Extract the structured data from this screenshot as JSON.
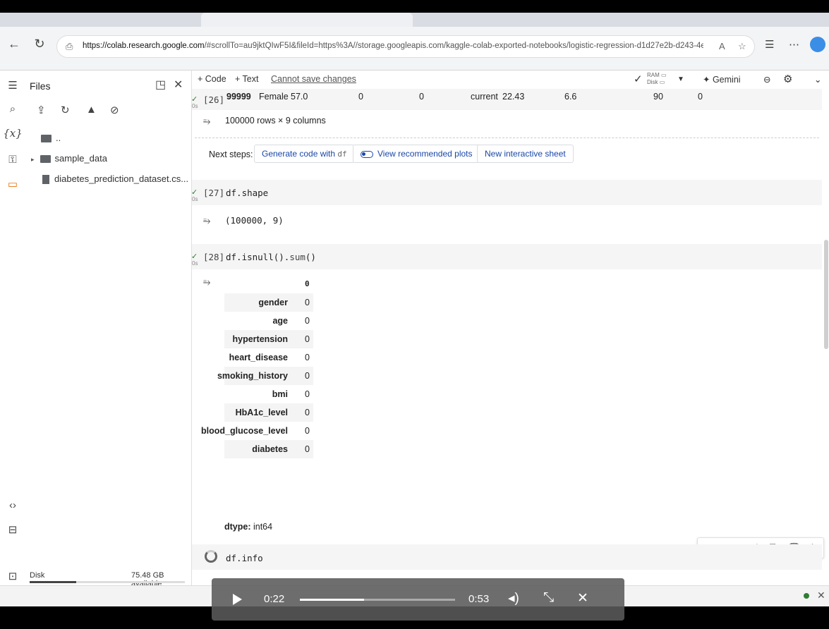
{
  "browser": {
    "url_host": "https://colab.research.google.com",
    "url_rest": "/#scrollTo=au9jktQIwF5I&fileId=https%3A//storage.googleapis.com/kaggle-colab-exported-notebooks/logistic-regression-d1d27e2b-d243-4e44-8011-..."
  },
  "files": {
    "title": "Files",
    "parent": "..",
    "items": [
      {
        "name": "sample_data",
        "type": "folder"
      },
      {
        "name": "diabetes_prediction_dataset.cs...",
        "type": "file"
      }
    ],
    "disk_label": "Disk",
    "disk_available": "75.48 GB available",
    "disk_used_fraction": 0.3
  },
  "toolbar": {
    "code": "+ Code",
    "text": "+ Text",
    "cannot_save": "Cannot save changes",
    "ram": "RAM",
    "disk": "Disk",
    "gemini": "Gemini"
  },
  "cells": {
    "c26": {
      "gutter": "0s",
      "prompt": "[26]",
      "row": {
        "index": "99999",
        "gender": "Female",
        "age": "57.0",
        "hyp": "0",
        "heart": "0",
        "smoke": "current",
        "bmi": "22.43",
        "hba1c": "6.6",
        "glucose": "90",
        "diab": "0"
      },
      "summary": "100000 rows × 9 columns",
      "next_steps": "Next steps:",
      "btn_generate": "Generate code with",
      "btn_generate_var": "df",
      "btn_plots": "View recommended plots",
      "btn_sheet": "New interactive sheet"
    },
    "c27": {
      "gutter": "0s",
      "prompt": "[27]",
      "code": "df.shape",
      "output": "(100000, 9)"
    },
    "c28": {
      "gutter": "0s",
      "prompt": "[28]",
      "code_obj": "df.isnull().",
      "code_fn": "sum",
      "code_end": "()",
      "col_header": "0",
      "rows": [
        {
          "k": "gender",
          "v": "0"
        },
        {
          "k": "age",
          "v": "0"
        },
        {
          "k": "hypertension",
          "v": "0"
        },
        {
          "k": "heart_disease",
          "v": "0"
        },
        {
          "k": "smoking_history",
          "v": "0"
        },
        {
          "k": "bmi",
          "v": "0"
        },
        {
          "k": "HbA1c_level",
          "v": "0"
        },
        {
          "k": "blood_glucose_level",
          "v": "0"
        },
        {
          "k": "diabetes",
          "v": "0"
        }
      ],
      "dtype_label": "dtype:",
      "dtype_value": "int64"
    },
    "c29": {
      "code": "df.info"
    }
  },
  "player": {
    "current": "0:22",
    "total": "0:53",
    "progress_fraction": 0.415
  }
}
